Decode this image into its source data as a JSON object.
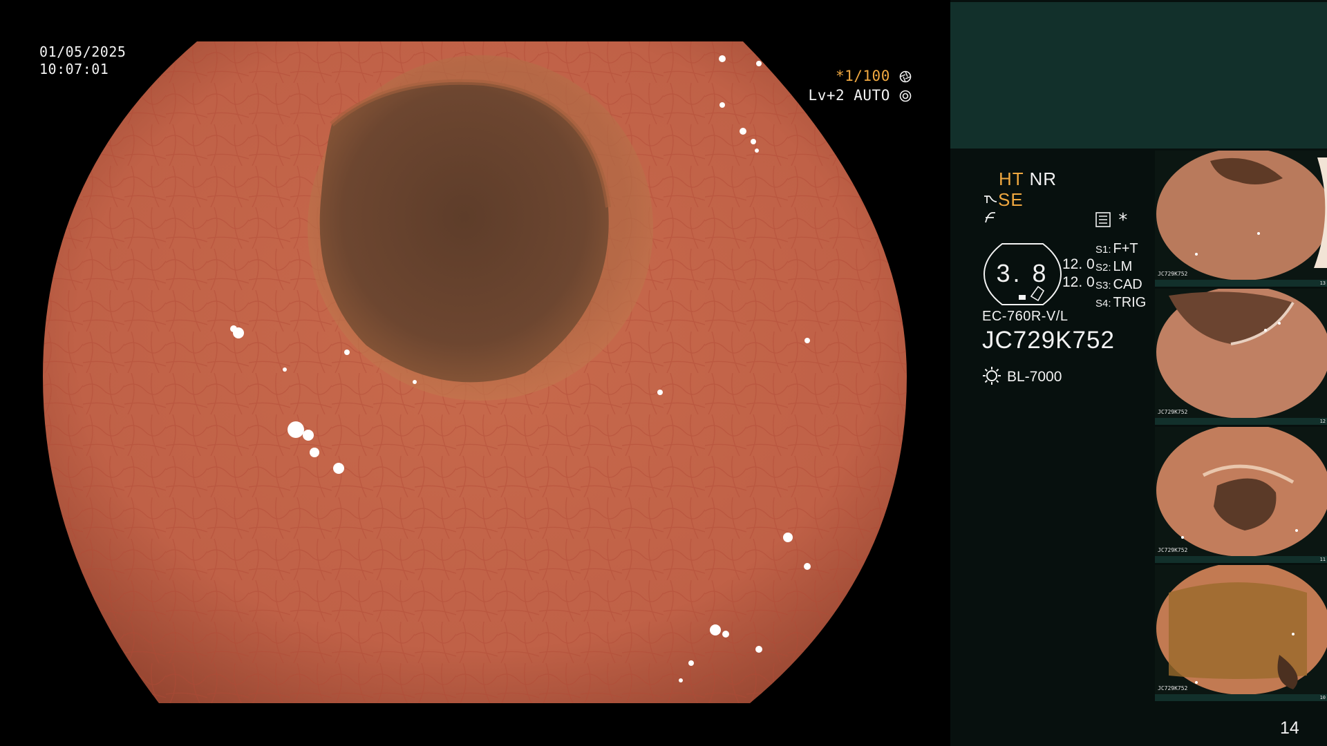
{
  "overlay": {
    "date": "01/05/2025",
    "time": "10:07:01",
    "shutter": "*1/100",
    "iris": "Lv+2 AUTO"
  },
  "panel": {
    "ht_label": "HT",
    "nr_label": "NR",
    "se_label": "SE",
    "star": "*",
    "gauge_value": "3. 8",
    "gain_values": [
      "12. 0",
      "12. 0"
    ],
    "scope_settings": [
      {
        "key": "S1:",
        "value": "F+T"
      },
      {
        "key": "S2:",
        "value": "LM"
      },
      {
        "key": "S3:",
        "value": "CAD"
      },
      {
        "key": "S4:",
        "value": "TRIG"
      }
    ],
    "model": "EC-760R-V/L",
    "serial": "JC729K752",
    "light_source": "BL-7000"
  },
  "thumbnails": [
    {
      "label": "JC729K752",
      "number": "13"
    },
    {
      "label": "JC729K752",
      "number": "12"
    },
    {
      "label": "JC729K752",
      "number": "11"
    },
    {
      "label": "JC729K752",
      "number": "10"
    }
  ],
  "page_number": "14",
  "colors": {
    "panel_top": "#12302b",
    "panel_body": "#07100e",
    "accent_orange": "#f0a840"
  },
  "icons": [
    "shutter-icon",
    "iris-icon",
    "structure-enhance-icon",
    "filter-icon",
    "menu-panel-icon",
    "light-source-icon"
  ]
}
